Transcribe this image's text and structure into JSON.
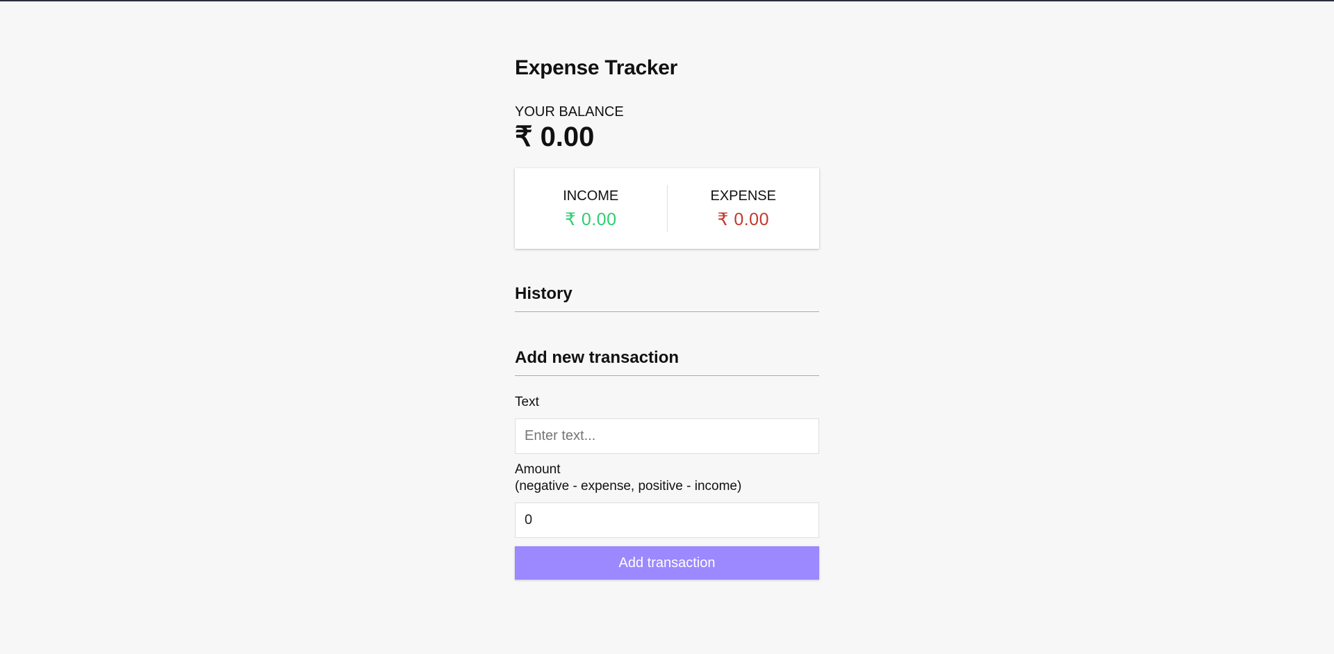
{
  "app": {
    "title": "Expense Tracker"
  },
  "balance": {
    "label": "YOUR BALANCE",
    "amount": "₹ 0.00"
  },
  "summary": {
    "income_label": "INCOME",
    "income_amount": "₹ 0.00",
    "expense_label": "EXPENSE",
    "expense_amount": "₹ 0.00"
  },
  "history": {
    "heading": "History",
    "items": []
  },
  "add_transaction": {
    "heading": "Add new transaction",
    "text_label": "Text",
    "text_placeholder": "Enter text...",
    "text_value": "",
    "amount_label": "Amount",
    "amount_hint": "(negative - expense, positive - income)",
    "amount_value": "0",
    "submit_label": "Add transaction"
  },
  "colors": {
    "background": "#f7f7f7",
    "income": "#2ecc71",
    "expense": "#c0392b",
    "accent_button": "#9c88ff"
  }
}
